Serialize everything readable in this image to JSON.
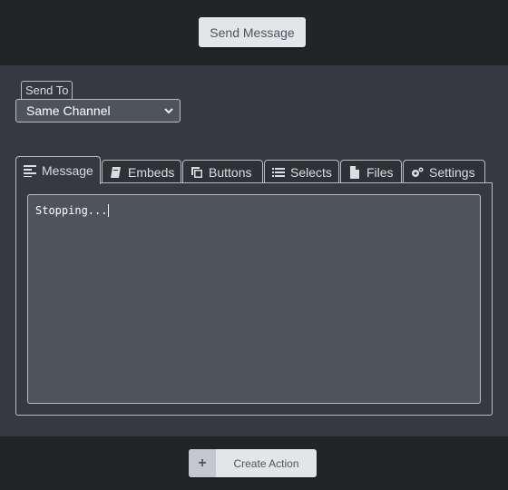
{
  "header": {
    "send_label": "Send Message"
  },
  "send_to": {
    "label": "Send To",
    "selected": "Same Channel"
  },
  "tabs": [
    {
      "label": "Message",
      "icon": "align-left-icon",
      "active": true
    },
    {
      "label": "Embeds",
      "icon": "book-icon"
    },
    {
      "label": "Buttons",
      "icon": "copy-icon"
    },
    {
      "label": "Selects",
      "icon": "list-icon"
    },
    {
      "label": "Files",
      "icon": "file-icon"
    },
    {
      "label": "Settings",
      "icon": "cogs-icon"
    }
  ],
  "message": {
    "content": "Stopping..."
  },
  "footer": {
    "create_label": "Create Action",
    "create_icon": "+"
  },
  "colors": {
    "page_bg": "#36393f",
    "bar_bg": "#232428",
    "input_bg": "#4f545c",
    "button_bg": "#e3e5e8"
  }
}
